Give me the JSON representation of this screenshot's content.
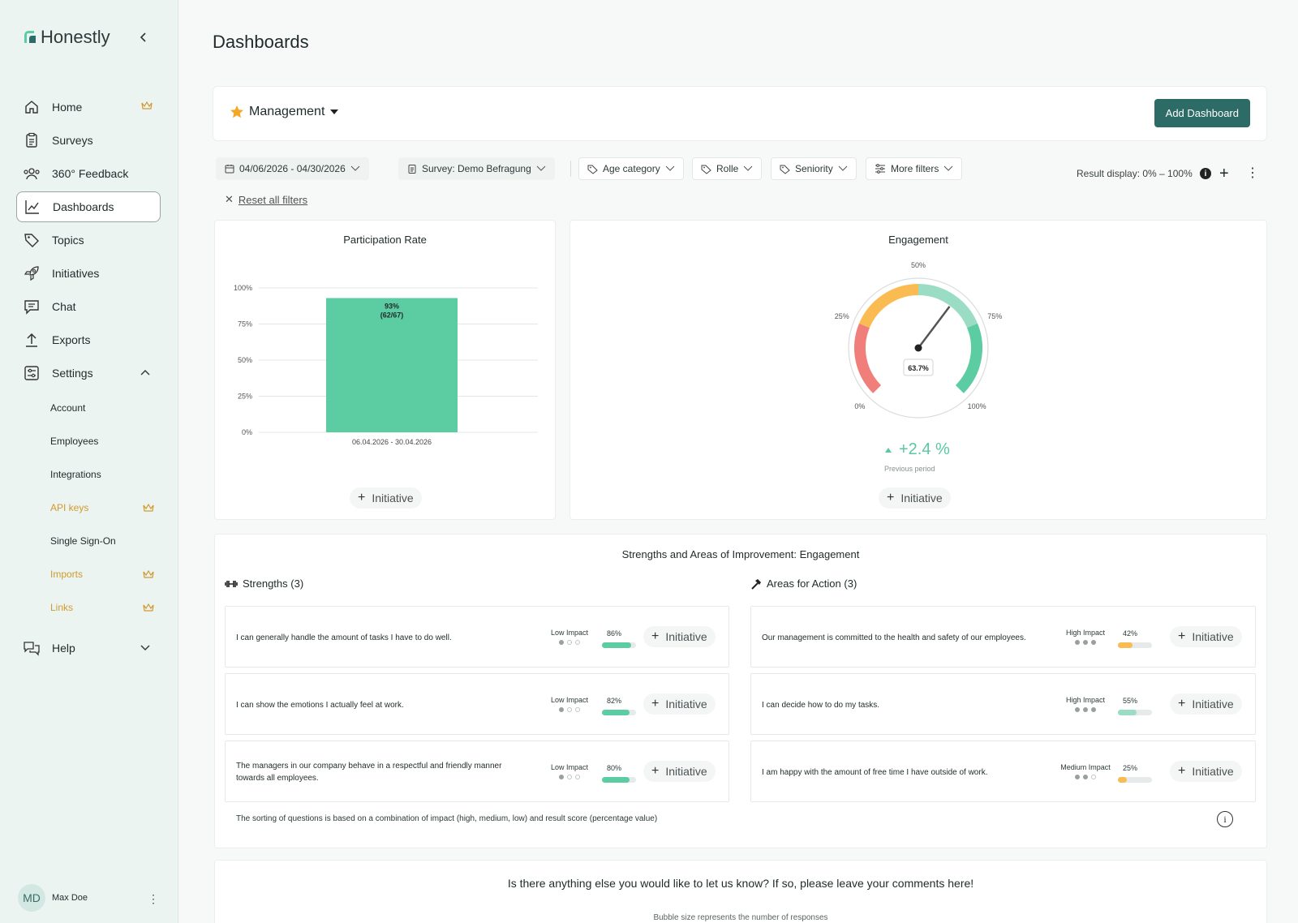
{
  "app": {
    "logo_text": "Honestly"
  },
  "sidebar": {
    "items": [
      {
        "label": "Home"
      },
      {
        "label": "Surveys"
      },
      {
        "label": "360° Feedback"
      },
      {
        "label": "Dashboards"
      },
      {
        "label": "Topics"
      },
      {
        "label": "Initiatives"
      },
      {
        "label": "Chat"
      },
      {
        "label": "Exports"
      },
      {
        "label": "Settings"
      },
      {
        "label": "Help"
      }
    ],
    "settings_items": [
      {
        "label": "Account"
      },
      {
        "label": "Employees"
      },
      {
        "label": "Integrations"
      },
      {
        "label": "API keys"
      },
      {
        "label": "Single Sign-On"
      },
      {
        "label": "Imports"
      },
      {
        "label": "Links"
      }
    ],
    "user": {
      "initials": "MD",
      "name": "Max Doe"
    }
  },
  "page": {
    "title": "Dashboards"
  },
  "dashboard": {
    "selected": "Management",
    "add_label": "Add Dashboard"
  },
  "filters": {
    "date_range": "04/06/2026 - 04/30/2026",
    "survey": "Survey: Demo Befragung",
    "age": "Age category",
    "role": "Rolle",
    "seniority": "Seniority",
    "more": "More filters",
    "result_display": "Result display: 0% – 100%",
    "reset": "Reset all filters"
  },
  "participation": {
    "title": "Participation Rate",
    "initiative_label": "Initiative"
  },
  "engagement": {
    "title": "Engagement",
    "delta": "+2.4 %",
    "delta_caption": "Previous period",
    "initiative_label": "Initiative"
  },
  "chart_data": [
    {
      "type": "bar",
      "title": "Participation Rate",
      "categories": [
        "06.04.2026 - 30.04.2026"
      ],
      "values": [
        93
      ],
      "data_labels": [
        "93%",
        "(62/67)"
      ],
      "ylim": [
        0,
        100
      ],
      "y_ticks": [
        "0%",
        "25%",
        "50%",
        "75%",
        "100%"
      ],
      "y_tick_values": [
        0,
        25,
        50,
        75,
        100
      ],
      "color": "#5ccda2",
      "grid": true
    },
    {
      "type": "gauge",
      "title": "Engagement",
      "value": 63.7,
      "value_label": "63.7%",
      "range": [
        0,
        100
      ],
      "tick_labels": [
        "0%",
        "25%",
        "50%",
        "75%",
        "100%"
      ],
      "tick_values": [
        0,
        25,
        50,
        75,
        100
      ],
      "bands": [
        {
          "from": 0,
          "to": 25,
          "color": "#f07f7b"
        },
        {
          "from": 25,
          "to": 50,
          "color": "#f9bb52"
        },
        {
          "from": 50,
          "to": 75,
          "color": "#9bdcc4"
        },
        {
          "from": 75,
          "to": 100,
          "color": "#5ccda2"
        }
      ]
    }
  ],
  "strengths_section": {
    "title": "Strengths and Areas of Improvement: Engagement",
    "strengths_label": "Strengths (3)",
    "actions_label": "Areas for Action (3)",
    "initiative_label": "Initiative",
    "strengths": [
      {
        "text": "I can generally handle the amount of tasks I have to do well.",
        "impact": "Low Impact",
        "impact_level": 1,
        "value": 86,
        "pct": "86%",
        "color": "#5ccda2"
      },
      {
        "text": "I can show the emotions I actually feel at work.",
        "impact": "Low Impact",
        "impact_level": 1,
        "value": 82,
        "pct": "82%",
        "color": "#5ccda2"
      },
      {
        "text": "The managers in our company behave in a respectful and friendly manner towards all employees.",
        "impact": "Low Impact",
        "impact_level": 1,
        "value": 80,
        "pct": "80%",
        "color": "#5ccda2"
      }
    ],
    "actions": [
      {
        "text": "Our management is committed to the health and safety of our employees.",
        "impact": "High Impact",
        "impact_level": 3,
        "value": 42,
        "pct": "42%",
        "color": "#f9bb52"
      },
      {
        "text": "I can decide how to do my tasks.",
        "impact": "High Impact",
        "impact_level": 3,
        "value": 55,
        "pct": "55%",
        "color": "#9bdcc4"
      },
      {
        "text": "I am happy with the amount of free time I have outside of work.",
        "impact": "Medium Impact",
        "impact_level": 2,
        "value": 25,
        "pct": "25%",
        "color": "#f9bb52"
      }
    ],
    "note": "The sorting of questions is based on a combination of impact (high, medium, low) and result score (percentage value)"
  },
  "comments": {
    "title": "Is there anything else you would like to let us know? If so, please leave your comments here!",
    "bubble_note": "Bubble size represents the number of responses"
  },
  "colors": {
    "accent": "#2c6b66",
    "premium": "#d19a2c",
    "positive": "#5ccda2"
  }
}
